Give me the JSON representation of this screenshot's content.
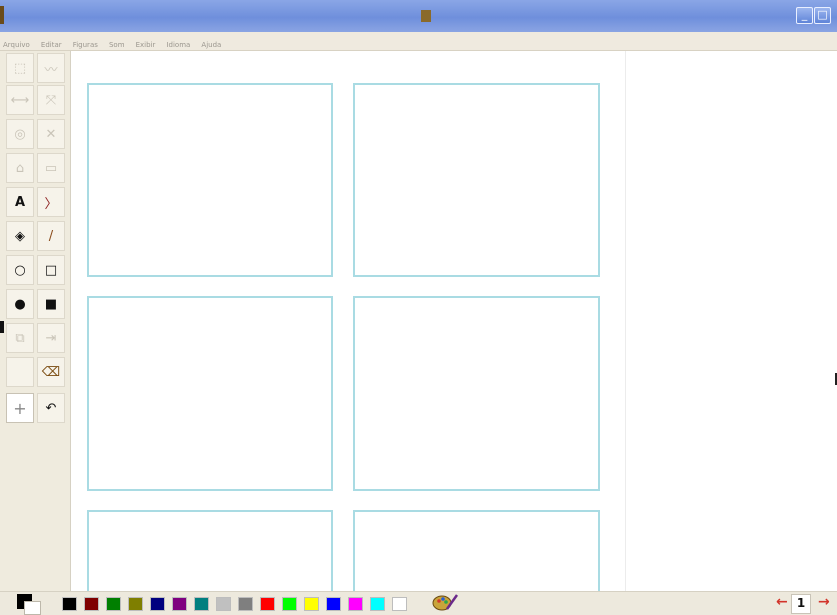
{
  "window": {
    "controls": [
      "_",
      "□"
    ]
  },
  "menubar": {
    "items": [
      "Arquivo",
      "Editar",
      "Figuras",
      "Som",
      "Exibir",
      "Idioma",
      "Ajuda"
    ]
  },
  "toolbox": {
    "tools": [
      {
        "name": "select-tool",
        "glyph": "⬚",
        "active": false
      },
      {
        "name": "freehand-select-tool",
        "glyph": "〰",
        "active": false
      },
      {
        "name": "flip-horizontal-tool",
        "glyph": "⟷",
        "active": false
      },
      {
        "name": "flip-vertical-tool",
        "glyph": "⤧",
        "active": false
      },
      {
        "name": "rotate-tool",
        "glyph": "◎",
        "active": false
      },
      {
        "name": "scale-tool",
        "glyph": "✕",
        "active": false
      },
      {
        "name": "fill-tool",
        "glyph": "⌂",
        "active": false
      },
      {
        "name": "frame-tool",
        "glyph": "▭",
        "active": false
      },
      {
        "name": "text-tool",
        "glyph": "A",
        "active": true
      },
      {
        "name": "line-tool",
        "glyph": "〉",
        "active": true
      },
      {
        "name": "sound-tool",
        "glyph": "◈",
        "active": true
      },
      {
        "name": "pencil-tool",
        "glyph": "/",
        "active": true
      },
      {
        "name": "ellipse-outline-tool",
        "glyph": "○",
        "active": true
      },
      {
        "name": "rectangle-outline-tool",
        "glyph": "□",
        "active": true
      },
      {
        "name": "ellipse-filled-tool",
        "glyph": "●",
        "active": true
      },
      {
        "name": "rectangle-filled-tool",
        "glyph": "■",
        "active": true
      },
      {
        "name": "copy-frame-tool",
        "glyph": "⧉",
        "active": false
      },
      {
        "name": "move-frame-tool",
        "glyph": "⇥",
        "active": false
      },
      {
        "name": "blank-tool",
        "glyph": "",
        "active": false
      },
      {
        "name": "eraser-tool",
        "glyph": "⌫",
        "active": true
      },
      {
        "name": "crosshair-tool",
        "glyph": "+",
        "active": false
      },
      {
        "name": "undo-tool",
        "glyph": "↶",
        "active": true
      }
    ]
  },
  "palette": {
    "colors": [
      "#000000",
      "#7f0000",
      "#007f00",
      "#7f7f00",
      "#00007f",
      "#7f007f",
      "#007f7f",
      "#c0c0c0",
      "#7f7f7f",
      "#ff0000",
      "#00ff00",
      "#ffff00",
      "#0000ff",
      "#ff00ff",
      "#00ffff",
      "#ffffff"
    ],
    "foreground": "#000000",
    "background": "#ffffff"
  },
  "page": {
    "prev_arrow": "←",
    "number": "1",
    "next_arrow": "→"
  },
  "theme": {
    "frame_border": "#a9dbe3",
    "titlebar": "#6f8fdc"
  }
}
